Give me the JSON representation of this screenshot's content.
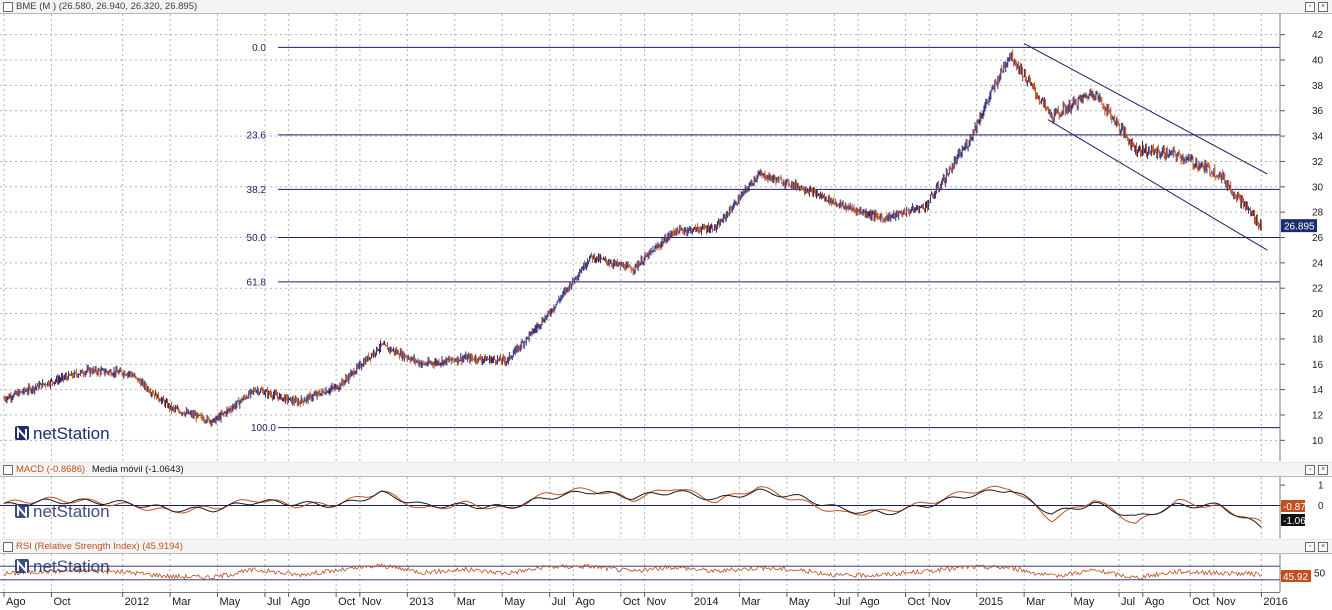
{
  "price_panel": {
    "header": "BME (M ) (26.580, 26.940, 26.320, 26.895)",
    "last_label": "26.895",
    "watermark": "netStation"
  },
  "macd_panel": {
    "header_macd": "MACD (-0.8686)",
    "header_signal": "Media móvil (-1.0643)",
    "macd_label": "-0.87",
    "signal_label": "-1.06",
    "watermark": "netStation"
  },
  "rsi_panel": {
    "header": "RSI (Relative Strength Index) (45.9194)",
    "rsi_label": "45.92",
    "watermark": "netStation"
  },
  "colors": {
    "accent": "#1c2d6e",
    "up": "#2a2a7a",
    "down": "#c0501e",
    "macd": "#1a1a1a",
    "signal": "#c0501e",
    "rsi": "#c0501e"
  },
  "chart_data": [
    {
      "type": "line",
      "title": "BME (M )",
      "ohlc_last": {
        "open": 26.58,
        "high": 26.94,
        "low": 26.32,
        "close": 26.895
      },
      "x": [
        "2011-08",
        "2011-10",
        "2012-01",
        "2012-03",
        "2012-05",
        "2012-07",
        "2012-08",
        "2012-10",
        "2012-11",
        "2013-01",
        "2013-03",
        "2013-05",
        "2013-07",
        "2013-08",
        "2013-10",
        "2013-11",
        "2014-01",
        "2014-03",
        "2014-05",
        "2014-07",
        "2014-08",
        "2014-10",
        "2014-11",
        "2015-01",
        "2015-03",
        "2015-05",
        "2015-07",
        "2015-08",
        "2015-10",
        "2015-11",
        "2016-01"
      ],
      "series": [
        {
          "values": [
            13.3,
            14.5,
            15.5,
            15.3,
            12.5,
            11.5,
            14.0,
            13.0,
            14.3,
            17.5,
            16.0,
            16.5,
            16.3,
            20.0,
            24.5,
            23.5,
            26.5,
            26.8,
            31.0,
            30.0,
            28.5,
            27.5,
            28.5,
            33.5,
            40.5,
            35.5,
            37.5,
            33.0,
            32.5,
            31.0,
            26.9
          ]
        }
      ],
      "x_ticks": [
        "Ago",
        "Oct",
        "2012",
        "Mar",
        "May",
        "Jul",
        "Ago",
        "Oct",
        "Nov",
        "2013",
        "Mar",
        "May",
        "Jul",
        "Ago",
        "Oct",
        "Nov",
        "2014",
        "Mar",
        "May",
        "Jul",
        "Ago",
        "Oct",
        "Nov",
        "2015",
        "Mar",
        "May",
        "Jul",
        "Ago",
        "Oct",
        "Nov",
        "2016"
      ],
      "y_ticks": [
        10,
        12,
        14,
        16,
        18,
        20,
        22,
        24,
        26,
        28,
        30,
        32,
        34,
        36,
        38,
        40,
        42
      ],
      "ylim": [
        9,
        43
      ],
      "fibonacci": [
        {
          "label": "0.0",
          "value": 41.0
        },
        {
          "label": "23.6",
          "value": 34.1
        },
        {
          "label": "38.2",
          "value": 29.8
        },
        {
          "label": "50.0",
          "value": 26.0
        },
        {
          "label": "61.8",
          "value": 22.5
        },
        {
          "label": "100.0",
          "value": 11.0
        }
      ],
      "channel": {
        "upper": [
          {
            "x": "2015-03",
            "y": 41.3
          },
          {
            "x": "2016-01",
            "y": 31.0
          }
        ],
        "lower": [
          {
            "x": "2015-04",
            "y": 35.3
          },
          {
            "x": "2016-01",
            "y": 25.0
          }
        ]
      },
      "grid": true
    },
    {
      "type": "line",
      "title": "MACD",
      "y_ticks": [
        1,
        0
      ],
      "ylim": [
        -1.6,
        1.4
      ],
      "series": [
        {
          "name": "MACD (-0.8686)",
          "values": [
            0.1,
            0.3,
            0.2,
            0.0,
            -0.3,
            -0.1,
            0.3,
            0.0,
            0.1,
            0.7,
            -0.2,
            0.1,
            -0.2,
            0.6,
            0.8,
            0.3,
            0.9,
            0.2,
            0.9,
            0.2,
            -0.4,
            -0.3,
            0.1,
            0.7,
            0.9,
            -0.7,
            0.3,
            -0.9,
            0.2,
            -0.1,
            -0.87
          ]
        },
        {
          "name": "Media móvil (-1.0643)",
          "values": [
            0.0,
            0.2,
            0.2,
            0.1,
            -0.2,
            -0.2,
            0.2,
            0.1,
            0.0,
            0.6,
            0.0,
            0.0,
            -0.1,
            0.4,
            0.7,
            0.4,
            0.7,
            0.3,
            0.7,
            0.4,
            -0.2,
            -0.4,
            0.0,
            0.5,
            0.8,
            -0.4,
            0.1,
            -0.6,
            0.0,
            0.0,
            -1.06
          ]
        }
      ]
    },
    {
      "type": "line",
      "title": "RSI (Relative Strength Index)",
      "y_ticks": [
        50
      ],
      "ylim": [
        0,
        100
      ],
      "series": [
        {
          "name": "RSI (Relative Strength Index) (45.9194)",
          "values": [
            48,
            55,
            58,
            52,
            40,
            38,
            60,
            45,
            58,
            72,
            52,
            60,
            50,
            68,
            70,
            55,
            68,
            55,
            66,
            58,
            42,
            45,
            55,
            68,
            66,
            40,
            58,
            36,
            55,
            50,
            45.92
          ]
        }
      ]
    }
  ]
}
